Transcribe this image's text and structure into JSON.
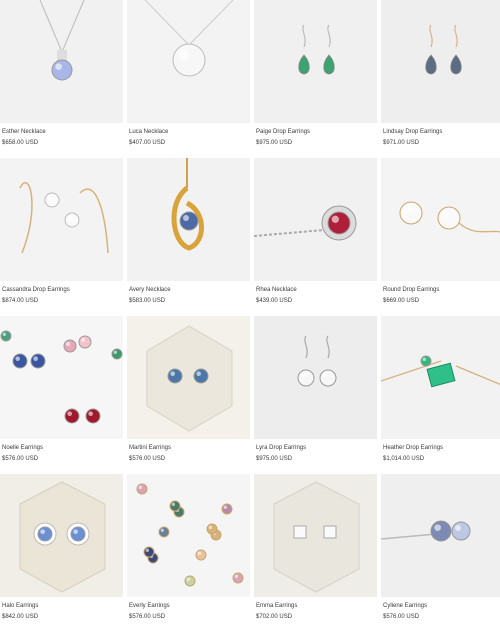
{
  "products": [
    {
      "name": "Esther Necklace",
      "price": "$658.00 USD",
      "image": "pendant-necklace-blue-oval",
      "bg": "#f1f1f1"
    },
    {
      "name": "Luca Necklace",
      "price": "$407.00 USD",
      "image": "pendant-necklace-clear-round",
      "bg": "#f3f3f3"
    },
    {
      "name": "Paige Drop Earrings",
      "price": "$975.00 USD",
      "image": "drop-earrings-green-pear",
      "bg": "#f0f0f0"
    },
    {
      "name": "Lindsay Drop Earrings",
      "price": "$971.00 USD",
      "image": "drop-earrings-teal-pear",
      "bg": "#eeeeee"
    },
    {
      "name": "Cassandra Drop Earrings",
      "price": "$874.00 USD",
      "image": "hook-earrings-clear-stones",
      "bg": "#f3f3f3"
    },
    {
      "name": "Avery Necklace",
      "price": "$583.00 USD",
      "image": "gold-swirl-pendant-blue",
      "bg": "#f2f2f2"
    },
    {
      "name": "Rhea Necklace",
      "price": "$439.00 USD",
      "image": "bezel-necklace-red-stone",
      "bg": "#f1f1f1"
    },
    {
      "name": "Round Drop Earrings",
      "price": "$669.00 USD",
      "image": "drop-earrings-clear-round",
      "bg": "#f4f4f4"
    },
    {
      "name": "Noelle Earrings",
      "price": "$576.00 USD",
      "image": "stud-earrings-multicolor",
      "bg": "#f6f6f6"
    },
    {
      "name": "Martini Earrings",
      "price": "$576.00 USD",
      "image": "stud-earrings-blue-in-box",
      "bg": "#f4f1ea"
    },
    {
      "name": "Lyra Drop Earrings",
      "price": "$975.00 USD",
      "image": "drop-earrings-clear-silver",
      "bg": "#ededed"
    },
    {
      "name": "Heather Drop Earrings",
      "price": "$1,014.00 USD",
      "image": "drop-earrings-green-emerald-cut",
      "bg": "#f2f2f2"
    },
    {
      "name": "Halo Earrings",
      "price": "$842.00 USD",
      "image": "halo-earrings-blue-in-box",
      "bg": "#f1eee7"
    },
    {
      "name": "Everly Earrings",
      "price": "$576.00 USD",
      "image": "stud-earrings-scattered",
      "bg": "#f5f5f5"
    },
    {
      "name": "Emma Earrings",
      "price": "$702.00 USD",
      "image": "stud-earrings-clear-square-in-box",
      "bg": "#efede8"
    },
    {
      "name": "Cyliene Earrings",
      "price": "$576.00 USD",
      "image": "stud-earrings-blue-side-view",
      "bg": "#efefef"
    }
  ]
}
